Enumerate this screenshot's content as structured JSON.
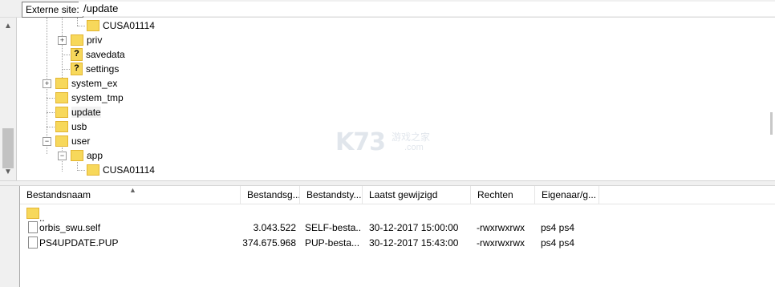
{
  "address_bar": {
    "label": "Externe site:",
    "path": "/update"
  },
  "tree": {
    "items": [
      {
        "label": "CUSA01114",
        "icon": "folder-icon"
      },
      {
        "label": "priv",
        "icon": "folder-icon"
      },
      {
        "label": "savedata",
        "icon": "unknown-folder-icon"
      },
      {
        "label": "settings",
        "icon": "unknown-folder-icon"
      },
      {
        "label": "system_ex",
        "icon": "folder-icon"
      },
      {
        "label": "system_tmp",
        "icon": "folder-icon"
      },
      {
        "label": "update",
        "icon": "folder-icon",
        "selected": true
      },
      {
        "label": "usb",
        "icon": "folder-icon"
      },
      {
        "label": "user",
        "icon": "folder-open-icon"
      },
      {
        "label": "app",
        "icon": "folder-open-icon"
      },
      {
        "label": "CUSA01114",
        "icon": "folder-icon"
      }
    ]
  },
  "file_list": {
    "columns": [
      "Bestandsnaam",
      "Bestandsg...",
      "Bestandsty...",
      "Laatst gewijzigd",
      "Rechten",
      "Eigenaar/g..."
    ],
    "rows": [
      {
        "name": "..",
        "size": "",
        "type": "",
        "modified": "",
        "perms": "",
        "owner": "",
        "icon": "folder-icon"
      },
      {
        "name": "orbis_swu.self",
        "size": "3.043.522",
        "type": "SELF-besta...",
        "modified": "30-12-2017 15:00:00",
        "perms": "-rwxrwxrwx",
        "owner": "ps4 ps4",
        "icon": "file-icon"
      },
      {
        "name": "PS4UPDATE.PUP",
        "size": "374.675.968",
        "type": "PUP-besta...",
        "modified": "30-12-2017 15:43:00",
        "perms": "-rwxrwxrwx",
        "owner": "ps4 ps4",
        "icon": "file-icon"
      }
    ]
  },
  "watermark": {
    "logo": "K73",
    "sub": "游戏之家",
    "domain": ".com"
  }
}
